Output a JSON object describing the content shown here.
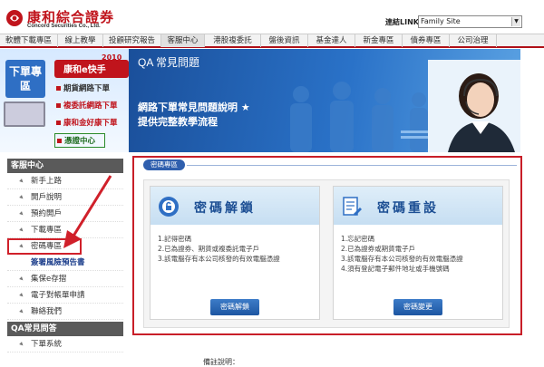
{
  "header": {
    "logo_cn": "康和綜合證券",
    "logo_en": "Concord Securities Co., Ltd.",
    "link_label": "連結LINK",
    "site_select": "Family Site"
  },
  "nav": [
    {
      "label": "軟體下載專區"
    },
    {
      "label": "線上教學"
    },
    {
      "label": "投顧研究報告"
    },
    {
      "label": "客服中心"
    },
    {
      "label": "港股複委託"
    },
    {
      "label": "盤後資訊"
    },
    {
      "label": "基金達人"
    },
    {
      "label": "新金專區"
    },
    {
      "label": "債券專區"
    },
    {
      "label": "公司治理"
    }
  ],
  "banner": {
    "left_title": "下單專區",
    "logo_text": "康和e快手",
    "logo_year": "2010",
    "menu": [
      {
        "label": "期貨網路下單"
      },
      {
        "label": "複委託網路下單"
      },
      {
        "label": "康和金好康下單"
      },
      {
        "label": "憑證中心"
      }
    ],
    "qa_title": "QA 常見問題",
    "line1": "網路下單常見問題說明 ★",
    "line2": "提供完整教學流程"
  },
  "sidebar": {
    "head": "客服中心",
    "items": [
      {
        "label": "新手上路"
      },
      {
        "label": "開戶說明"
      },
      {
        "label": "預約開戶"
      },
      {
        "label": "下載專區"
      },
      {
        "label": "密碼專區"
      },
      {
        "label": "簽署風險預告書"
      },
      {
        "label": "集保e存摺"
      },
      {
        "label": "電子對帳單申請"
      },
      {
        "label": "聯絡我們"
      }
    ],
    "head2": "QA常見問答",
    "items2": [
      {
        "label": "下單系統"
      }
    ]
  },
  "content": {
    "crumb": "密碼專區",
    "unlock": {
      "title": "密碼解鎖",
      "list": [
        "1.記得密碼",
        "2.已為證券、期貨或複委託電子戶",
        "3.該電腦存有本公司核發的有效電腦憑證"
      ],
      "button": "密碼解鎖"
    },
    "reset": {
      "title": "密碼重設",
      "list": [
        "1.忘記密碼",
        "2.已為證券或期貨電子戶",
        "3.該電腦存有本公司核發的有效電腦憑證",
        "4.須有登記電子郵件地址或手機號碼"
      ],
      "button": "密碼變更"
    },
    "remark": "備註說明："
  },
  "colors": {
    "brand_red": "#c0141c",
    "highlight_red": "#d0202a",
    "nav_blue": "#1b56a8"
  }
}
